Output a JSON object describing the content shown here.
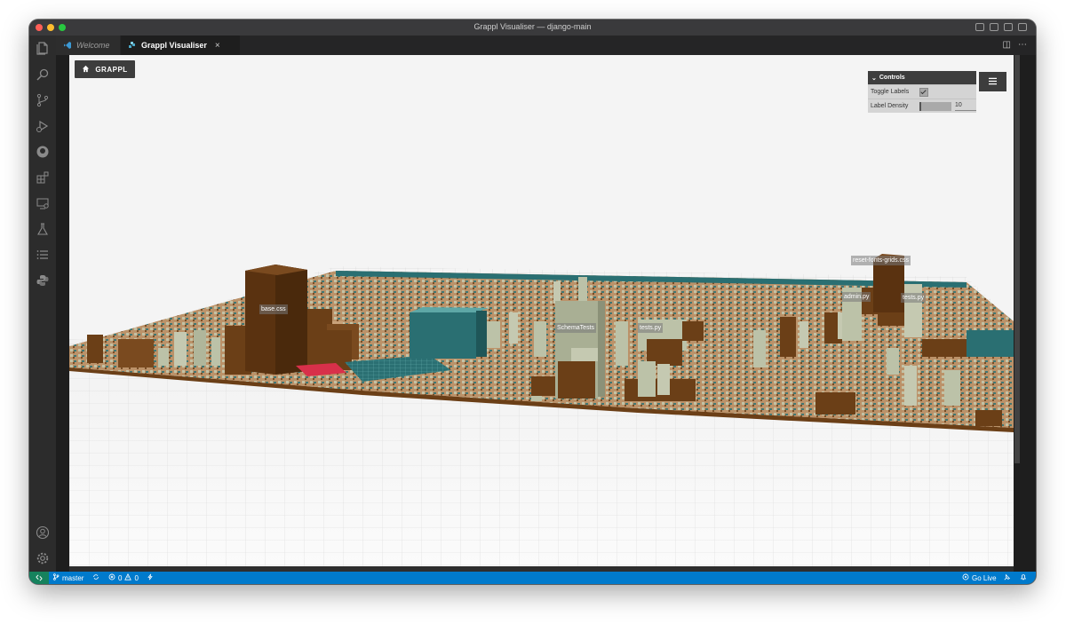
{
  "window": {
    "title": "Grappl Visualiser — django-main"
  },
  "tabs": [
    {
      "label": "Welcome",
      "active": false
    },
    {
      "label": "Grappl Visualiser",
      "active": true
    }
  ],
  "activity_icons": [
    "files-icon",
    "search-icon",
    "source-control-icon",
    "run-debug-icon",
    "github-icon",
    "extensions-icon",
    "remote-explorer-icon",
    "testing-icon",
    "list-icon",
    "python-icon",
    "account-icon",
    "settings-gear-icon"
  ],
  "grappl": {
    "home_label": "GRAPPL",
    "controls_title": "Controls",
    "toggle_labels": "Toggle Labels",
    "toggle_checked": true,
    "label_density": "Label Density",
    "label_density_value": "10"
  },
  "building_labels": [
    {
      "text": "base.css"
    },
    {
      "text": "SchemaTests"
    },
    {
      "text": "tests.py"
    },
    {
      "text": "admin.py"
    },
    {
      "text": "tests.py"
    },
    {
      "text": "reset-fonts-grids.css"
    }
  ],
  "status": {
    "branch": "master",
    "errors": "0",
    "warnings": "0",
    "go_live": "Go Live"
  },
  "colors": {
    "statusbar": "#007acc",
    "remote": "#16825d",
    "folder": "#6b3f17",
    "file": "#bcc2a8",
    "highlight": "#2a6f72"
  }
}
